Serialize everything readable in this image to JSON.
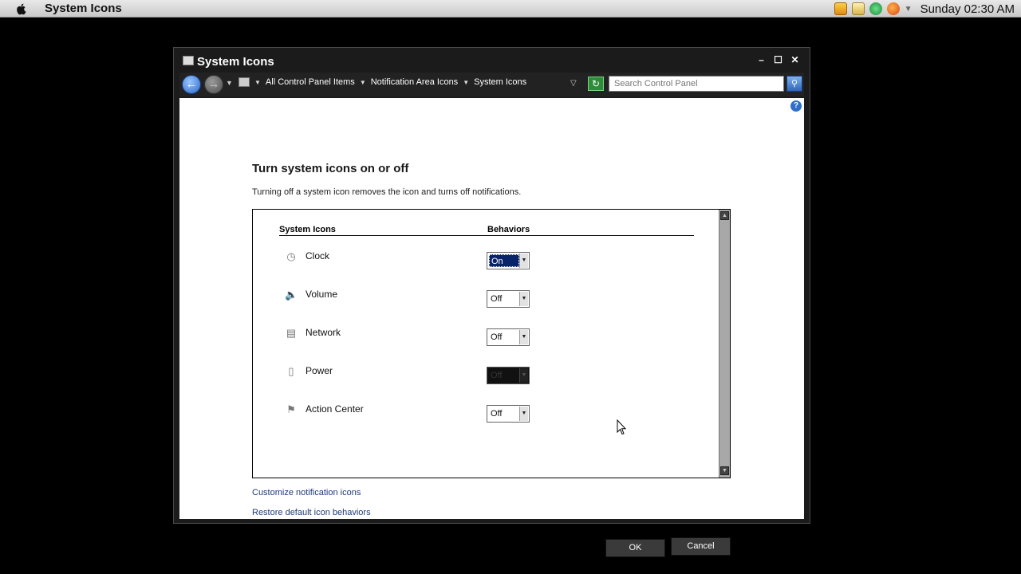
{
  "menubar": {
    "app_title": "System Icons",
    "clock": "Sunday 02:30 AM",
    "tray_icons": [
      "media-icon",
      "folder-icon",
      "messenger-icon",
      "firefox-icon"
    ]
  },
  "window": {
    "title": "System Icons",
    "nav": {
      "breadcrumbs": [
        "All Control Panel Items",
        "Notification Area Icons",
        "System Icons"
      ],
      "search_placeholder": "Search Control Panel"
    },
    "heading": "Turn system icons on or off",
    "description": "Turning off a system icon removes the icon and turns off notifications.",
    "columns": {
      "icons": "System Icons",
      "behaviors": "Behaviors"
    },
    "rows": [
      {
        "label": "Clock",
        "icon": "clock-icon",
        "value": "On",
        "state": "active"
      },
      {
        "label": "Volume",
        "icon": "volume-icon",
        "value": "Off",
        "state": "normal"
      },
      {
        "label": "Network",
        "icon": "network-icon",
        "value": "Off",
        "state": "normal"
      },
      {
        "label": "Power",
        "icon": "power-icon",
        "value": "Off",
        "state": "disabled"
      },
      {
        "label": "Action Center",
        "icon": "flag-icon",
        "value": "Off",
        "state": "normal"
      }
    ],
    "links": {
      "customize": "Customize notification icons",
      "restore": "Restore default icon behaviors"
    },
    "buttons": {
      "ok": "OK",
      "cancel": "Cancel"
    }
  },
  "colors": {
    "window_bg": "#1b1b1b",
    "content_bg": "#ffffff",
    "selection": "#0a246a",
    "link": "#1f3a7a"
  }
}
